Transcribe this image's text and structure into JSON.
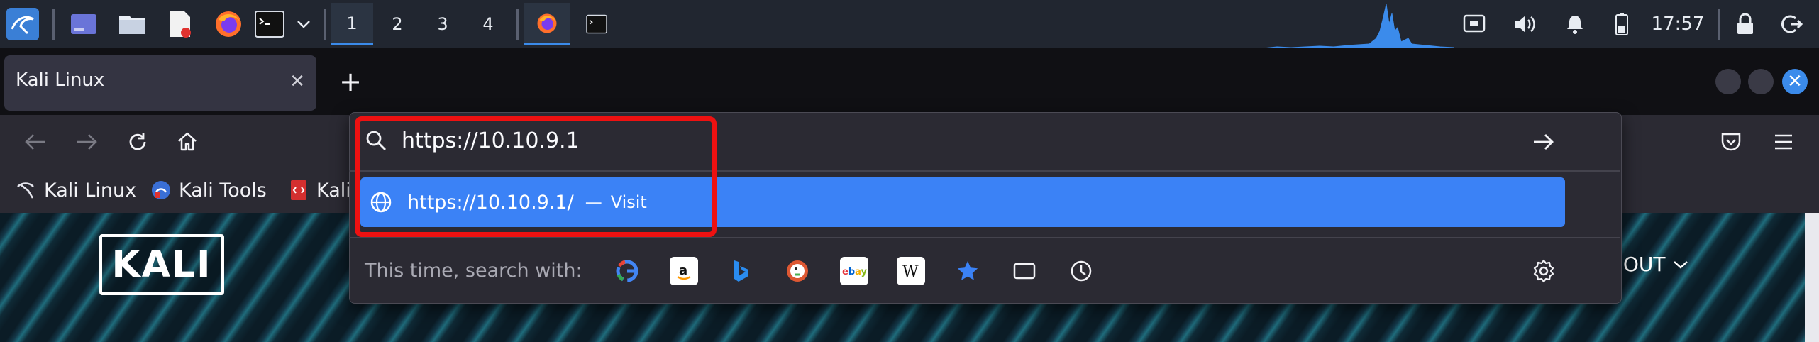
{
  "taskbar": {
    "workspaces": [
      "1",
      "2",
      "3",
      "4"
    ],
    "active_workspace": "1",
    "clock": "17:57"
  },
  "browser": {
    "tab": {
      "title": "Kali Linux",
      "close_symbol": "✕"
    },
    "new_tab_symbol": "+",
    "bookmarks": [
      {
        "label": "Kali Linux"
      },
      {
        "label": "Kali Tools"
      },
      {
        "label": "Kali"
      }
    ]
  },
  "urlbar": {
    "value": "https://10.10.9.1",
    "suggestion": {
      "url": "https://10.10.9.1/",
      "dash": "—",
      "action": "Visit"
    },
    "search_with_label": "This time, search with:",
    "engines": [
      "google-icon",
      "amazon-icon",
      "bing-icon",
      "duckduckgo-icon",
      "ebay-icon",
      "wikipedia-icon",
      "bookmarks-star-icon",
      "tabs-icon",
      "history-icon"
    ]
  },
  "page": {
    "logo_text": "KALI",
    "nav_about": "ABOUT"
  },
  "colors": {
    "accent": "#3b82f6",
    "highlight": "#ee1111",
    "toolbar": "#2b2a33",
    "taskbar": "#212630"
  }
}
